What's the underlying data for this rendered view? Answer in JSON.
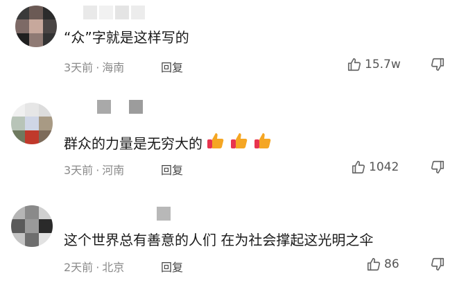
{
  "comments": [
    {
      "text": "“众”字就是这样写的",
      "time": "3天前",
      "location": "海南",
      "reply_label": "回复",
      "likes": "15.7w",
      "emoji_count": 0
    },
    {
      "text": "群众的力量是无穷大的",
      "time": "3天前",
      "location": "河南",
      "reply_label": "回复",
      "likes": "1042",
      "emoji_count": 3
    },
    {
      "text": "这个世界总有善意的人们 在为社会撑起这光明之伞",
      "time": "2天前",
      "location": "北京",
      "reply_label": "回复",
      "likes": "86",
      "emoji_count": 0
    }
  ],
  "icons": {
    "like": "thumbs-up-outline-icon",
    "dislike": "thumbs-down-outline-icon",
    "emoji": "thumbs-up-emoji-icon"
  },
  "colors": {
    "text": "#1a1a1a",
    "meta": "#8a8a8a",
    "emoji": "#f5a623"
  }
}
